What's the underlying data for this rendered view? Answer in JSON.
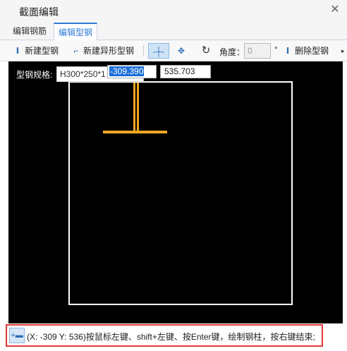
{
  "window": {
    "title": "截面编辑",
    "close_glyph": "✕"
  },
  "tabs": [
    {
      "label": "编辑钢筋",
      "active": false
    },
    {
      "label": "编辑型钢",
      "active": true
    }
  ],
  "toolbar": {
    "new_steel": "新建型钢",
    "new_special_steel": "新建异形型钢",
    "angle_label": "角度：",
    "angle_value": "0",
    "degree_symbol": "°",
    "delete_steel": "删除型钢"
  },
  "canvas": {
    "spec_label": "型钢规格:",
    "spec_value": "H300*250*1",
    "coord_x": "-309.390",
    "coord_y": "535.703",
    "shape_color": "#f5a623",
    "outline_color": "#ffffff"
  },
  "status": {
    "text": "(X: -309 Y: 536)按鼠标左键、shift+左键、按Enter键，绘制钢柱，按右键结束;"
  },
  "colors": {
    "accent": "#2d7ad6",
    "highlight_border": "#e53935",
    "canvas_bg": "#000000"
  },
  "icons": [
    "close-icon",
    "new-steel-icon",
    "new-special-steel-icon",
    "crosshair-icon",
    "move-icon",
    "rotate-icon",
    "delete-steel-icon",
    "more-arrow-icon",
    "point-draw-icon"
  ]
}
